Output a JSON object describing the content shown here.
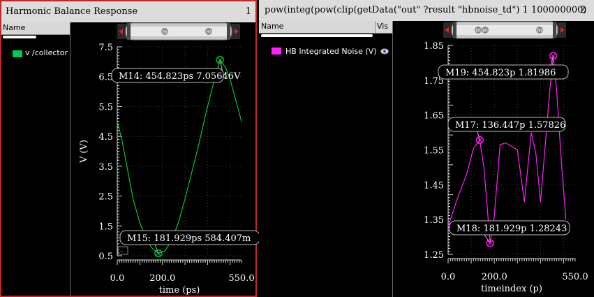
{
  "colors": {
    "active_border": "#c0282a",
    "trace_green": "#00c832",
    "trace_magenta": "#ff22ff",
    "legend_green": "#00c850",
    "legend_magenta": "#ff22ff"
  },
  "left": {
    "title": "Harmonic Balance Response",
    "number": "1",
    "legend_header": "Name",
    "legend_entry": "v /collector",
    "overlay_icon": "-"
  },
  "right": {
    "title": "pow(integ(pow(clip(getData(\"out\" ?result \"hbnoise_td\") 1 100000000)",
    "number": "2",
    "legend_header": "Name",
    "legend_vis": "Vis",
    "legend_entry": "HB Integrated Noise (V)",
    "legend_icon": "eye-icon"
  },
  "chart_data": [
    {
      "type": "line",
      "title": "Harmonic Balance Response",
      "xlabel": "time (ps)",
      "ylabel": "V (V)",
      "xlim": [
        0,
        550
      ],
      "ylim": [
        0.5,
        7.5
      ],
      "x_ticks": [
        "0.0",
        "200.0",
        "550.0"
      ],
      "y_ticks": [
        "0.5",
        "1.5",
        "2.5",
        "3.5",
        "4.5",
        "5.5",
        "6.5",
        "7.5"
      ],
      "grid": true,
      "series": [
        {
          "name": "v /collector",
          "color": "#00c832",
          "x": [
            0,
            20,
            45,
            70,
            100,
            130,
            155,
            182,
            210,
            240,
            270,
            300,
            330,
            360,
            390,
            420,
            455,
            480,
            500,
            525,
            550
          ],
          "y": [
            5.0,
            4.4,
            3.4,
            2.4,
            1.6,
            1.0,
            0.75,
            0.58,
            0.66,
            1.0,
            1.6,
            2.4,
            3.3,
            4.2,
            5.2,
            6.1,
            7.06,
            6.8,
            6.4,
            5.7,
            5.0
          ]
        }
      ],
      "markers": [
        {
          "label": "M14: 454.823ps 7.05646V",
          "x": 455,
          "y": 7.06
        },
        {
          "label": "M15: 181.929ps 584.407m",
          "x": 182,
          "y": 0.58
        }
      ]
    },
    {
      "type": "line",
      "title": "pow(integ(pow(clip(getData(\"out\" ?result \"hbnoise_td\") 1 100000000)",
      "xlabel": "timeindex (p)",
      "ylabel": "",
      "xlim": [
        0,
        550
      ],
      "ylim": [
        1.25,
        1.85
      ],
      "x_ticks": [
        "0.0",
        "200.0",
        "550.0"
      ],
      "y_ticks": [
        "1.25",
        "1.35",
        "1.45",
        "1.55",
        "1.65",
        "1.75",
        "1.85"
      ],
      "grid": true,
      "series": [
        {
          "name": "HB Integrated Noise (V)",
          "color": "#ff22ff",
          "x": [
            0,
            40,
            80,
            110,
            137,
            155,
            182,
            200,
            225,
            250,
            275,
            300,
            330,
            360,
            380,
            400,
            425,
            440,
            455,
            470,
            490,
            510
          ],
          "y": [
            1.33,
            1.41,
            1.48,
            1.555,
            1.578,
            1.5,
            1.282,
            1.36,
            1.565,
            1.57,
            1.56,
            1.55,
            1.4,
            1.6,
            1.54,
            1.4,
            1.6,
            1.72,
            1.82,
            1.72,
            1.52,
            1.35
          ]
        }
      ],
      "markers": [
        {
          "label": "M19: 454.823p 1.81986",
          "x": 455,
          "y": 1.81986
        },
        {
          "label": "M17: 136.447p 1.57826",
          "x": 137,
          "y": 1.578
        },
        {
          "label": "M18: 181.929p 1.28243",
          "x": 182,
          "y": 1.282
        }
      ]
    }
  ]
}
